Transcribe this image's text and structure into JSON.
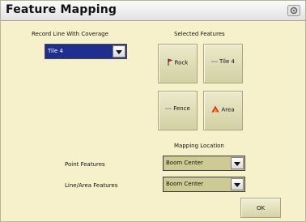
{
  "window": {
    "title": "Feature Mapping",
    "title_icon": "gear-icon"
  },
  "record_line": {
    "label": "Record Line With Coverage",
    "selected": "Tile 4"
  },
  "selected_features": {
    "label": "Selected  Features",
    "buttons": [
      {
        "label": "Rock",
        "icon": "flag-icon"
      },
      {
        "label": "Tile 4",
        "icon": "line-icon"
      },
      {
        "label": "Fence",
        "icon": "line-icon"
      },
      {
        "label": "Area",
        "icon": "area-triangle-icon"
      }
    ]
  },
  "mapping_location": {
    "label": "Mapping Location",
    "point_features_label": "Point Features",
    "point_features_value": "Boom Center",
    "line_area_features_label": "Line/Area Features",
    "line_area_features_value": "Boom Center"
  },
  "ok_label": "OK",
  "colors": {
    "background": "#f7f1cb",
    "dropdown_blue": "#1e2f8f",
    "dropdown_olive": "#cdcb93",
    "flag_red": "#c01818",
    "line_gray": "#b2b2b2"
  }
}
